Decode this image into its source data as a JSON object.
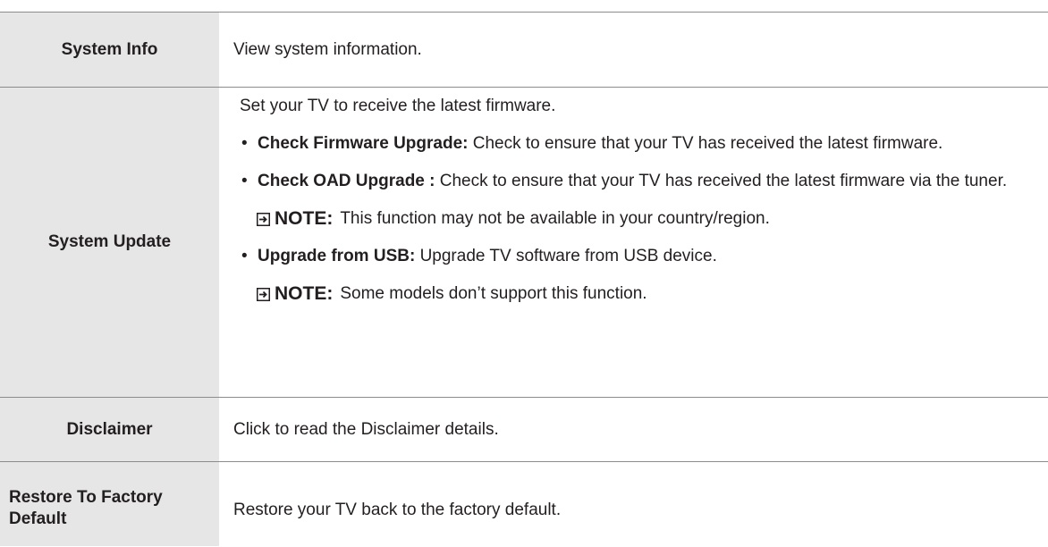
{
  "rows": {
    "system_info": {
      "label": "System Info",
      "description": "View system information."
    },
    "system_update": {
      "label": "System Update",
      "intro": "Set your TV to receive the latest firmware.",
      "bullets": [
        {
          "title": "Check Firmware Upgrade:",
          "text": " Check to ensure that your TV has received the latest firmware."
        },
        {
          "title": "Check OAD Upgrade :",
          "text": " Check to ensure that your TV has received the latest firmware via the tuner."
        },
        {
          "title": "Upgrade from USB:",
          "text": " Upgrade TV software from USB device."
        }
      ],
      "notes": [
        {
          "label": "NOTE:",
          "text": "This function may not be available in your country/region."
        },
        {
          "label": "NOTE:",
          "text": "Some models don’t support this function."
        }
      ]
    },
    "disclaimer": {
      "label": "Disclaimer",
      "description": "Click to read the Disclaimer details."
    },
    "restore": {
      "label": "Restore To Factory Default",
      "description": "Restore your TV back to the factory default."
    }
  },
  "icons": {
    "note": "note-arrow-icon"
  }
}
